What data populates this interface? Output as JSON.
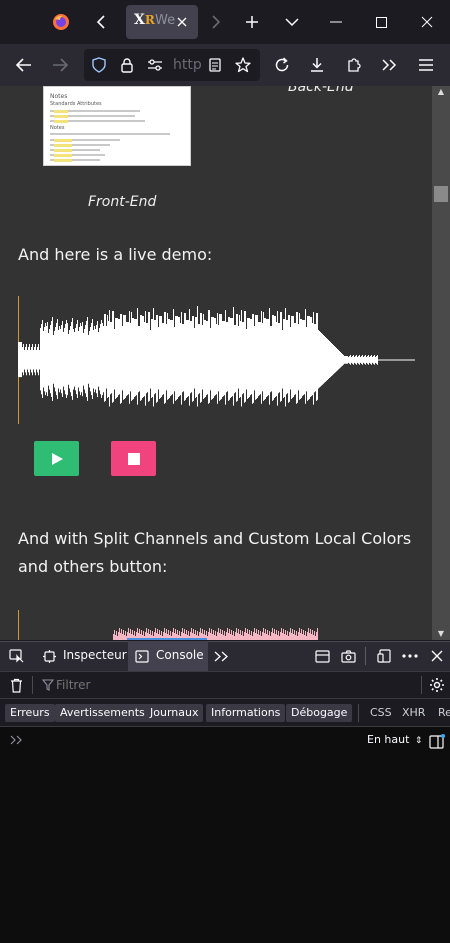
{
  "browser": {
    "tab": {
      "title": "We",
      "logo_text": "X",
      "logo_sub": "R"
    },
    "url": {
      "display": "http"
    }
  },
  "page": {
    "thumbnail": {
      "heading": "Notes",
      "sub1": "Standards Attributes",
      "sub2": "Notes"
    },
    "caption_front": "Front-End",
    "caption_back": "Back-End",
    "live_demo_text": "And here is a live demo:",
    "split_text": "And with Split Channels and Custom Local Colors and others button:",
    "buttons": {
      "play": "play",
      "stop": "stop"
    },
    "colors": {
      "play": "#2ebd73",
      "stop": "#f1447e",
      "cursor": "#d49a2a",
      "wave": "#ffffff",
      "wave2": "#f4b6c2"
    }
  },
  "devtools": {
    "tabs": {
      "inspector": "Inspecteur",
      "console": "Console"
    },
    "filter_placeholder": "Filtrer",
    "categories": [
      "Erreurs",
      "Avertissements",
      "Journaux",
      "Informations",
      "Débogage"
    ],
    "net_filters": [
      "CSS",
      "XHR",
      "Re"
    ],
    "position_label": "En haut"
  }
}
